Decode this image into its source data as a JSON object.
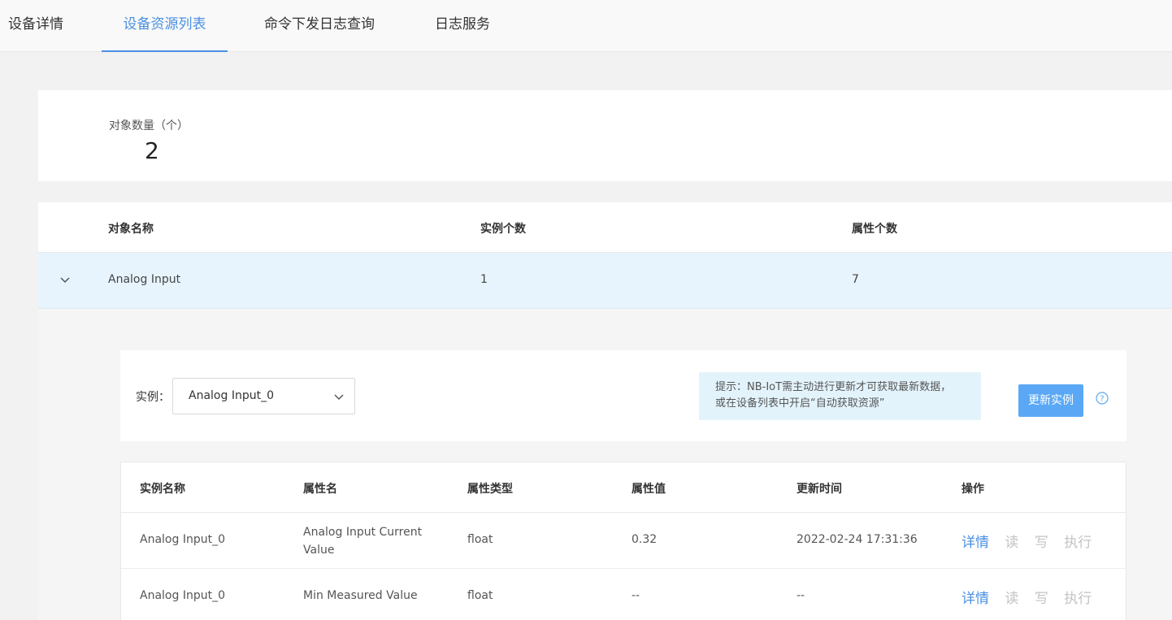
{
  "tabs": [
    {
      "label": "设备详情"
    },
    {
      "label": "设备资源列表"
    },
    {
      "label": "命令下发日志查询"
    },
    {
      "label": "日志服务"
    }
  ],
  "summary": {
    "label": "对象数量（个）",
    "value": "2"
  },
  "object_table": {
    "headers": [
      "对象名称",
      "实例个数",
      "属性个数"
    ],
    "rows": [
      {
        "name": "Analog Input",
        "instances": "1",
        "attributes": "7"
      }
    ]
  },
  "instance": {
    "label": "实例：",
    "selected": "Analog Input_0",
    "hint_line1": "提示：NB-IoT需主动进行更新才可获取最新数据，",
    "hint_line2": "或在设备列表中开启“自动获取资源”",
    "update_button": "更新实例"
  },
  "property_table": {
    "headers": [
      "实例名称",
      "属性名",
      "属性类型",
      "属性值",
      "更新时间",
      "操作"
    ],
    "rows": [
      {
        "instance": "Analog Input_0",
        "name": "Analog Input Current Value",
        "type": "float",
        "value": "0.32",
        "time": "2022-02-24 17:31:36"
      },
      {
        "instance": "Analog Input_0",
        "name": "Min Measured Value",
        "type": "float",
        "value": "--",
        "time": "--"
      }
    ],
    "actions": {
      "detail": "详情",
      "read": "读",
      "write": "写",
      "execute": "执行"
    }
  },
  "colors": {
    "accent": "#4a90e2",
    "selected_row": "#e8f4fd",
    "hint_bg": "#e3f3fc",
    "button": "#5aa8f5"
  },
  "icons": {
    "expand": "chevron-down-icon",
    "select": "chevron-down-icon",
    "help": "question-circle-icon"
  }
}
